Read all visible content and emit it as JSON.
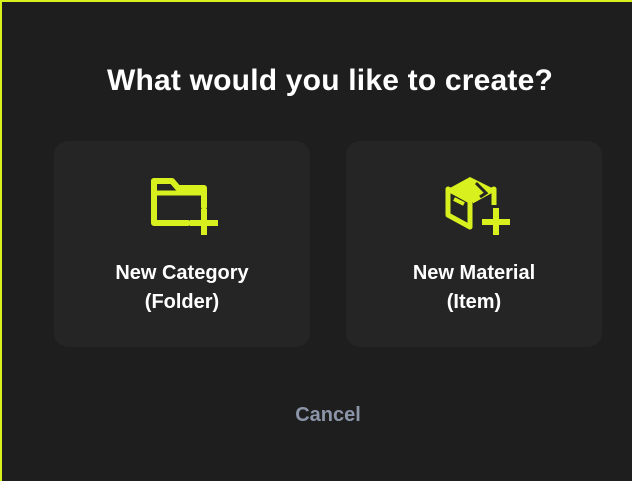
{
  "dialog": {
    "title": "What would you like to create?",
    "accent_color": "#d8f01e",
    "options": [
      {
        "icon": "folder-plus-icon",
        "label_line1": "New Category",
        "label_line2": "(Folder)"
      },
      {
        "icon": "box-plus-icon",
        "label_line1": "New Material",
        "label_line2": "(Item)"
      }
    ],
    "cancel_label": "Cancel"
  }
}
